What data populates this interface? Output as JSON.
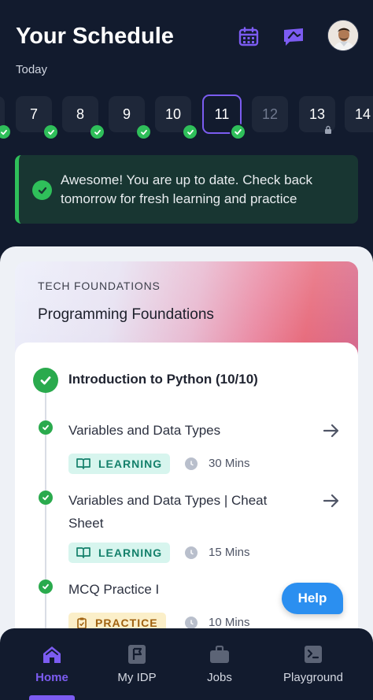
{
  "header": {
    "title": "Your Schedule",
    "subtitle": "Today",
    "calendar_icon": "calendar-icon",
    "announce_icon": "megaphone-icon",
    "avatar_icon": "user-avatar"
  },
  "days": [
    {
      "label": "",
      "status": "completed"
    },
    {
      "label": "7",
      "status": "completed"
    },
    {
      "label": "8",
      "status": "completed"
    },
    {
      "label": "9",
      "status": "completed"
    },
    {
      "label": "10",
      "status": "completed"
    },
    {
      "label": "11",
      "status": "selected-completed"
    },
    {
      "label": "12",
      "status": "upcoming"
    },
    {
      "label": "13",
      "status": "locked"
    },
    {
      "label": "14",
      "status": "upcoming"
    }
  ],
  "banner": {
    "text": "Awesome! You are up to date. Check back tomorrow for fresh learning and practice"
  },
  "course": {
    "category": "TECH FOUNDATIONS",
    "title": "Programming Foundations",
    "module_title": "Introduction to Python (10/10)",
    "items": [
      {
        "title": "Variables and Data Types",
        "tag": "LEARNING",
        "duration": "30 Mins"
      },
      {
        "title": "Variables and Data Types | Cheat Sheet",
        "tag": "LEARNING",
        "duration": "15 Mins"
      },
      {
        "title": "MCQ Practice I",
        "tag": "PRACTICE",
        "duration": "10 Mins"
      }
    ]
  },
  "help": {
    "label": "Help"
  },
  "nav": {
    "items": [
      {
        "label": "Home",
        "icon": "home-icon",
        "active": true
      },
      {
        "label": "My IDP",
        "icon": "flag-icon",
        "active": false
      },
      {
        "label": "Jobs",
        "icon": "briefcase-icon",
        "active": false
      },
      {
        "label": "Playground",
        "icon": "terminal-icon",
        "active": false
      }
    ]
  },
  "colors": {
    "background": "#121b2e",
    "accent": "#7c5cf2",
    "success": "#2fbf5a",
    "help": "#2b8ff0"
  }
}
